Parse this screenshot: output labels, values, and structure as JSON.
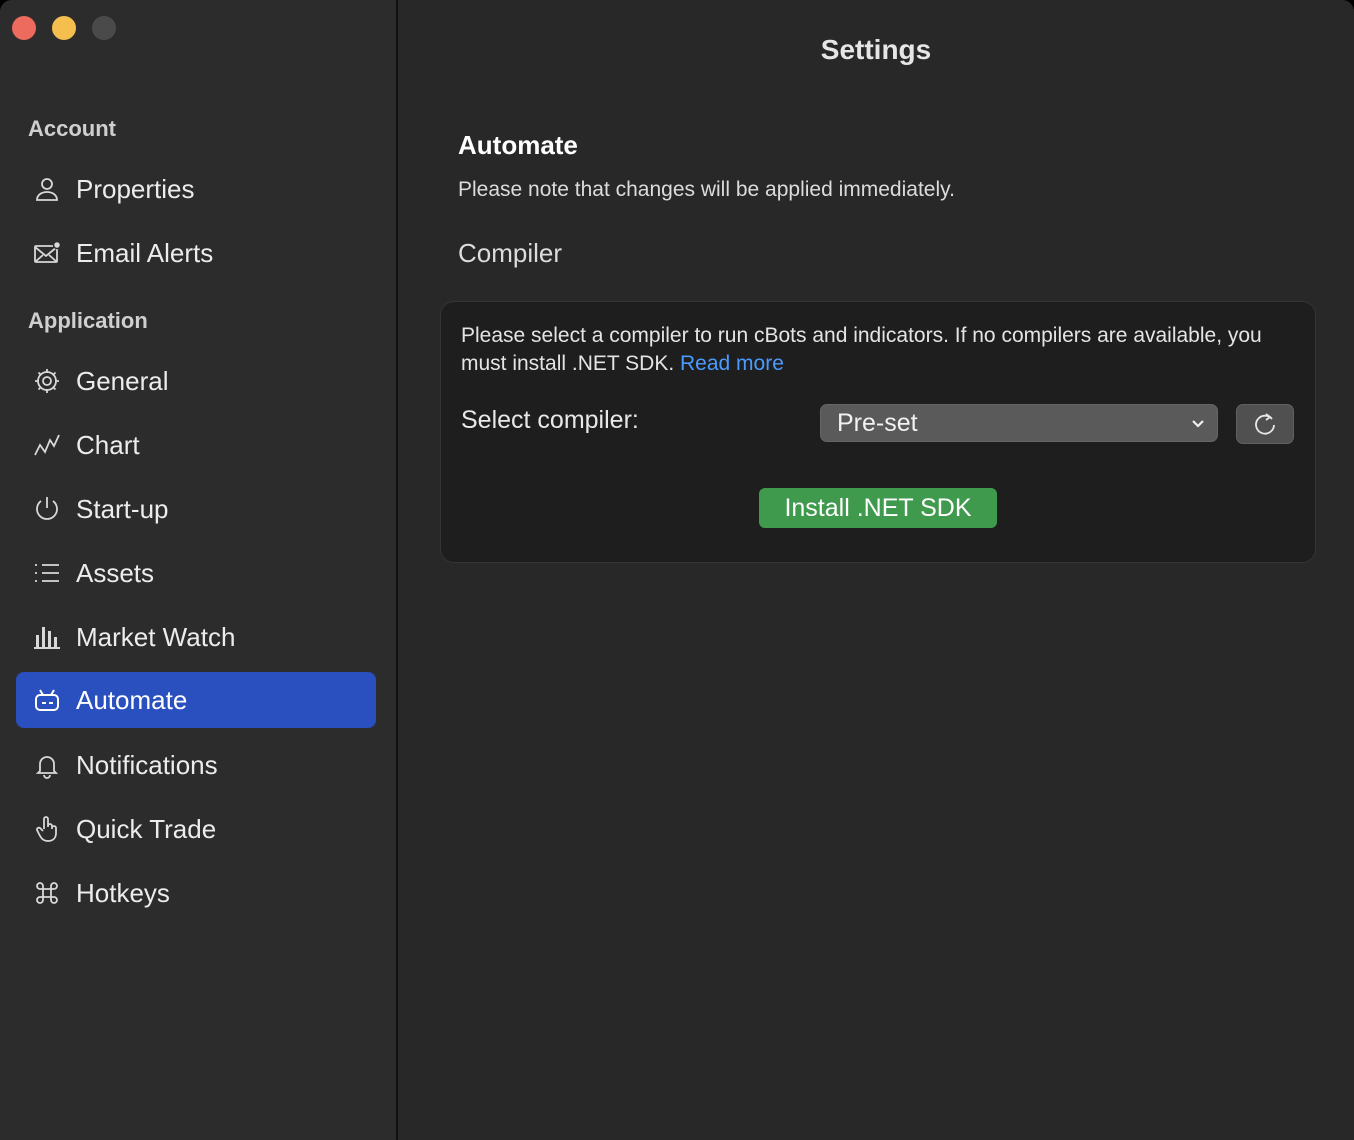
{
  "window": {
    "title": "Settings"
  },
  "sidebar": {
    "sections": [
      {
        "label": "Account",
        "items": [
          {
            "label": "Properties",
            "icon": "person-icon"
          },
          {
            "label": "Email Alerts",
            "icon": "envelope-icon"
          }
        ]
      },
      {
        "label": "Application",
        "items": [
          {
            "label": "General",
            "icon": "gear-icon"
          },
          {
            "label": "Chart",
            "icon": "chart-line-icon"
          },
          {
            "label": "Start-up",
            "icon": "power-icon"
          },
          {
            "label": "Assets",
            "icon": "list-icon"
          },
          {
            "label": "Market Watch",
            "icon": "bar-chart-icon"
          },
          {
            "label": "Automate",
            "icon": "robot-icon",
            "selected": true
          },
          {
            "label": "Notifications",
            "icon": "bell-icon"
          },
          {
            "label": "Quick Trade",
            "icon": "hand-pointer-icon"
          },
          {
            "label": "Hotkeys",
            "icon": "command-icon"
          }
        ]
      }
    ]
  },
  "main": {
    "section_title": "Automate",
    "note": "Please note that changes will be applied immediately.",
    "subsection_title": "Compiler",
    "card": {
      "description": "Please select a compiler to run cBots and indicators. If no compilers are available, you must install .NET SDK.",
      "link_text": "Read more",
      "select_label": "Select compiler:",
      "select_value": "Pre-set",
      "install_button": "Install .NET SDK"
    }
  },
  "colors": {
    "selected_bg": "#2a4fbf",
    "link": "#4b9bff",
    "install_button": "#3f9a4e",
    "close": "#ec6a5e",
    "minimize": "#f4bf4f"
  }
}
